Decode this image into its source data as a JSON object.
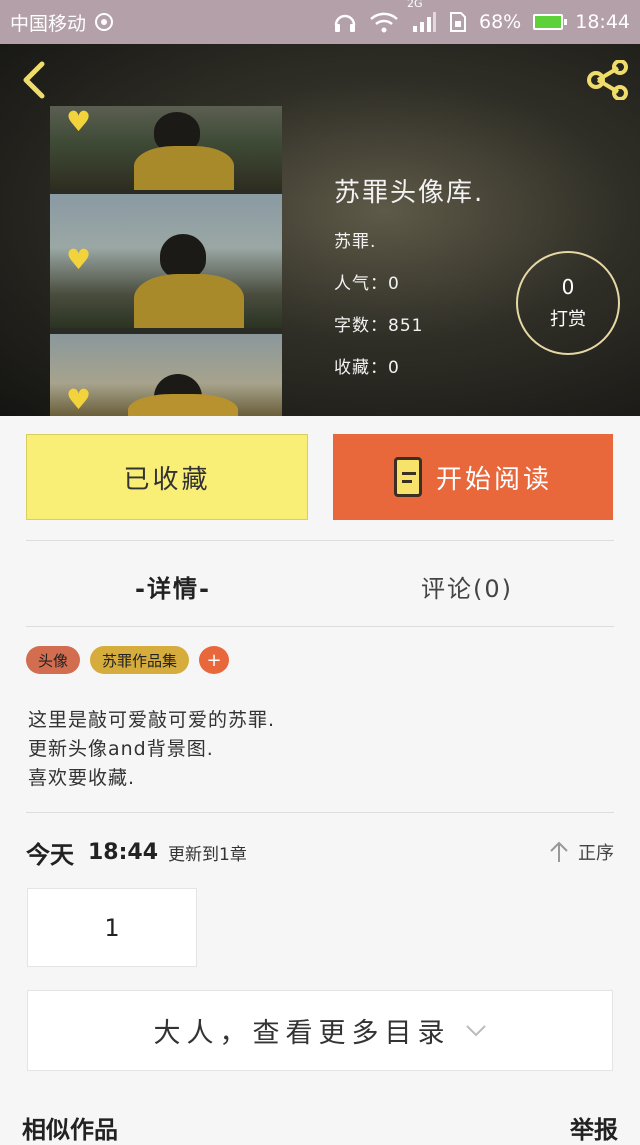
{
  "status_bar": {
    "carrier": "中国移动",
    "network": "2G",
    "battery": "68%",
    "time": "18:44"
  },
  "header": {
    "back_icon": "chevron-left-icon",
    "share_icon": "share-icon"
  },
  "book": {
    "title": "苏罪头像库.",
    "author": "苏罪.",
    "popularity": "人气：0",
    "word_count": "字数：851",
    "favorites": "收藏：0"
  },
  "tip": {
    "count": "0",
    "label": "打赏"
  },
  "actions": {
    "collected_label": "已收藏",
    "read_label": "开始阅读"
  },
  "tabs": {
    "detail": "-详情-",
    "comments": "评论(0)"
  },
  "tags": [
    "头像",
    "苏罪作品集",
    "+"
  ],
  "description": [
    "这里是敲可爱敲可爱的苏罪.",
    "更新头像and背景图.",
    "喜欢要收藏."
  ],
  "update": {
    "day": "今天",
    "time": "18:44",
    "text": "更新到1章",
    "sort_label": "正序"
  },
  "chapters": [
    "1"
  ],
  "more": {
    "label": "大人，查看更多目录"
  },
  "footer": {
    "similar": "相似作品",
    "report": "举报"
  },
  "colors": {
    "status_bar": "#b3a0a8",
    "collected_bg": "#f9ef76",
    "read_bg": "#e8673b",
    "tag_1": "#d36d50",
    "tag_2": "#d6ac3c"
  }
}
